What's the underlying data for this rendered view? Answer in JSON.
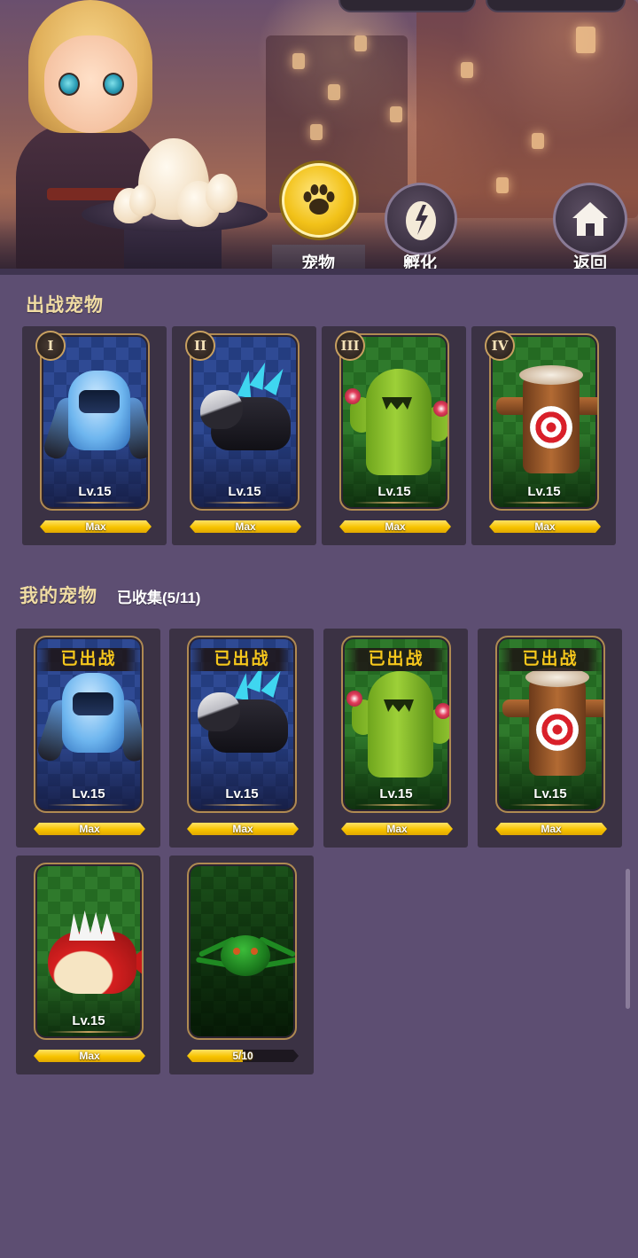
{
  "tabs": {
    "pets": {
      "label": "宠物",
      "icon": "paw-icon",
      "active": true
    },
    "hatch": {
      "label": "孵化",
      "icon": "egg-hatch-icon"
    },
    "back": {
      "label": "返回",
      "icon": "home-icon"
    }
  },
  "deployed_section": {
    "title": "出战宠物",
    "cards": [
      {
        "slot": "I",
        "pet": "robot",
        "level": "Lv.15",
        "bar_text": "Max",
        "progress": 1.0
      },
      {
        "slot": "II",
        "pet": "wolf",
        "level": "Lv.15",
        "bar_text": "Max",
        "progress": 1.0
      },
      {
        "slot": "III",
        "pet": "cactus",
        "level": "Lv.15",
        "bar_text": "Max",
        "progress": 1.0
      },
      {
        "slot": "IV",
        "pet": "target-dummy",
        "level": "Lv.15",
        "bar_text": "Max",
        "progress": 1.0
      }
    ]
  },
  "my_pets_section": {
    "title": "我的宠物",
    "collected": "已收集(5/11)",
    "cards": [
      {
        "pet": "robot",
        "status": "已出战",
        "level": "Lv.15",
        "bar_text": "Max",
        "progress": 1.0
      },
      {
        "pet": "wolf",
        "status": "已出战",
        "level": "Lv.15",
        "bar_text": "Max",
        "progress": 1.0
      },
      {
        "pet": "cactus",
        "status": "已出战",
        "level": "Lv.15",
        "bar_text": "Max",
        "progress": 1.0
      },
      {
        "pet": "target-dummy",
        "status": "已出战",
        "level": "Lv.15",
        "bar_text": "Max",
        "progress": 1.0
      },
      {
        "pet": "piranha",
        "level": "Lv.15",
        "bar_text": "Max",
        "progress": 1.0
      },
      {
        "pet": "spider",
        "locked": true,
        "bar_text": "5/10",
        "progress": 0.5
      }
    ]
  },
  "colors": {
    "background": "#5d4e72",
    "card": "#3b3244",
    "accent_yellow": "#f7c300",
    "section_title": "#f0dca3"
  }
}
